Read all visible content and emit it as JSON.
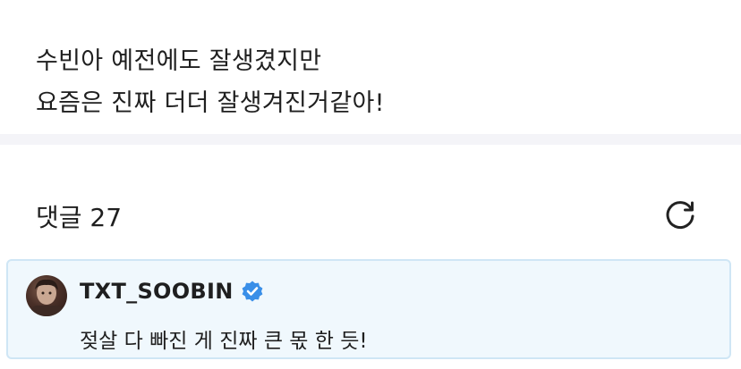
{
  "post": {
    "line1": "수빈아 예전에도 잘생겼지만",
    "line2": "요즘은 진짜 더더 잘생겨진거같아!"
  },
  "comments": {
    "title": "댓글 27",
    "refresh_icon": "refresh-icon"
  },
  "pinned_comment": {
    "username": "TXT_SOOBIN",
    "verified_icon": "verified-badge-icon",
    "verified_color": "#3a8fe8",
    "text": "젖살 다 빠진 게 진짜 큰 몫 한 듯!"
  }
}
